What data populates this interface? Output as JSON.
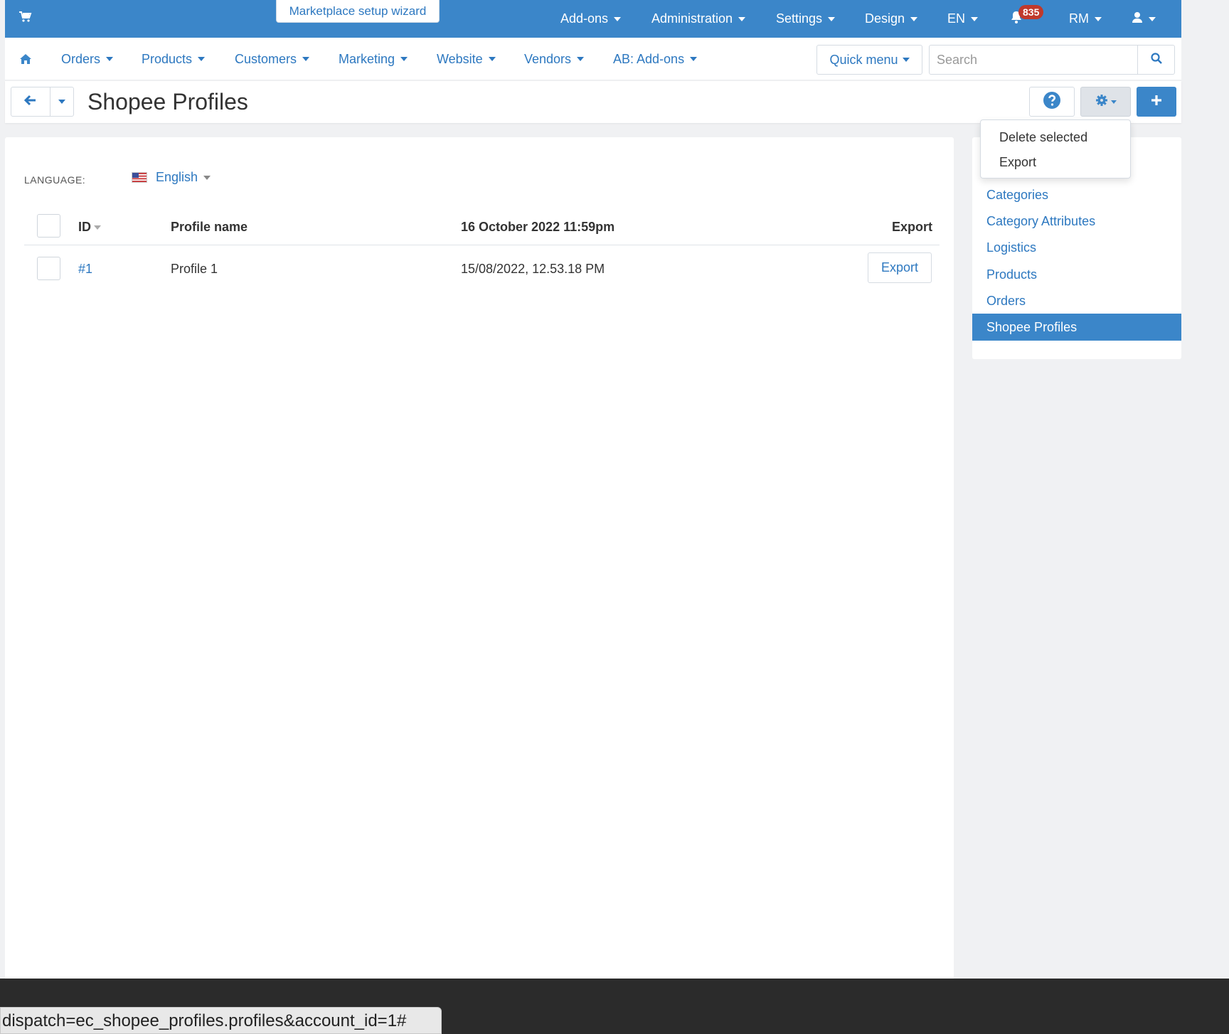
{
  "topbar": {
    "wizard_label": "Marketplace setup wizard",
    "menus": [
      "Add-ons",
      "Administration",
      "Settings",
      "Design",
      "EN"
    ],
    "notifications_count": "835",
    "currency": "RM"
  },
  "nav": {
    "items": [
      "Orders",
      "Products",
      "Customers",
      "Marketing",
      "Website",
      "Vendors",
      "AB: Add-ons"
    ],
    "quick_menu": "Quick menu",
    "search_placeholder": "Search"
  },
  "page": {
    "title": "Shopee Profiles"
  },
  "gear_menu": {
    "items": [
      "Delete selected",
      "Export"
    ]
  },
  "filters": {
    "language_label": "LANGUAGE:",
    "language_value": "English"
  },
  "table": {
    "columns": [
      "ID",
      "Profile name",
      "16 October 2022 11:59pm",
      "Export"
    ],
    "rows": [
      {
        "id": "#1",
        "name": "Profile 1",
        "date": "15/08/2022, 12.53.18 PM",
        "action": "Export"
      }
    ]
  },
  "sidebar": {
    "items": [
      "Categories",
      "Category Attributes",
      "Logistics",
      "Products",
      "Orders",
      "Shopee Profiles"
    ],
    "active": "Shopee Profiles"
  },
  "status_bar": {
    "url": "dispatch=ec_shopee_profiles.profiles&account_id=1#"
  },
  "colors": {
    "primary": "#3b86c9",
    "link": "#2d78c0",
    "badge": "#c0392b"
  }
}
